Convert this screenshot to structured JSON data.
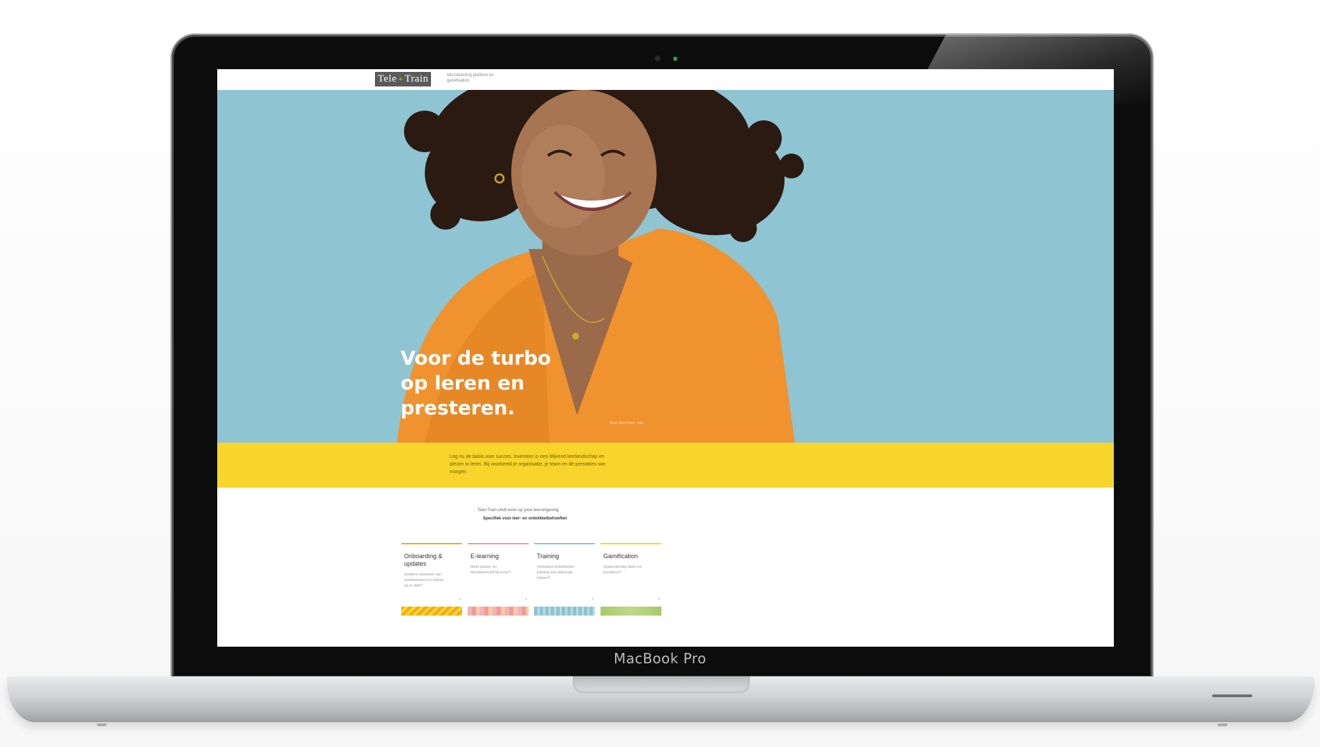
{
  "device": {
    "model_label": "MacBook Pro"
  },
  "site": {
    "logo_left": "Tele",
    "logo_plus": "+",
    "logo_right": "Train",
    "logo_tagline": "Microlearning platform en gamification"
  },
  "hero": {
    "title": "Voor de turbo\nop leren en\npresteren.",
    "caption": "Bron Tele+Train · foto"
  },
  "band": {
    "text": "Leg nu de basis voor succes. Investeer in een blijvend leerlandschap en plezier in leren. Bij voorbeeld je organisatie, je team en de prestaties van morgen."
  },
  "intro": {
    "small": "Tele+Train vindt leren op jouw leeromgeving",
    "strong": "Specifiek voor leer- en ontwikkelbehoeften"
  },
  "cards": [
    {
      "title": "Onboarding & updates",
      "text": "Snellere inwerken van medewerkers en blijven up to date?",
      "arrow": "›",
      "color": "#f4a81d"
    },
    {
      "title": "E-learning",
      "text": "Meer plezier en betrokkenheid bij leren?",
      "arrow": "›",
      "color": "#f29b9b"
    },
    {
      "title": "Training",
      "text": "Verbeterd ontwikkelen training met blijvende impact?",
      "arrow": "›",
      "color": "#8fc4d2"
    },
    {
      "title": "Gamification",
      "text": "Spelenderwijs leren en presteren?",
      "arrow": "›",
      "color": "#f8d52a"
    }
  ],
  "colors": {
    "hero_background": "#8fc4d2",
    "band_yellow": "#f8d52a",
    "cardigan_orange": "#f0922e"
  }
}
